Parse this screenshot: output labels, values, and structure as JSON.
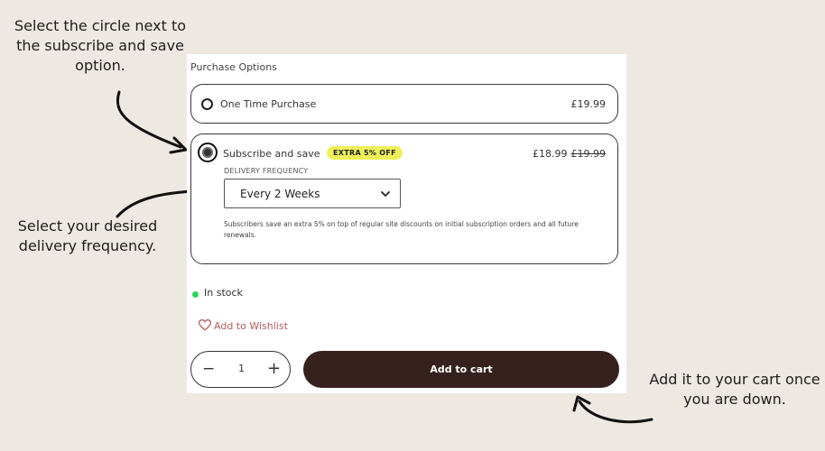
{
  "annotations": {
    "radio_hint": "Select the circle next to the subscribe and save option.",
    "frequency_hint": "Select your desired delivery frequency.",
    "cart_hint": "Add it to your cart once you are down."
  },
  "purchase": {
    "heading": "Purchase Options",
    "one_time": {
      "label": "One Time Purchase",
      "price": "£19.99",
      "selected": false
    },
    "subscribe": {
      "label": "Subscribe and save",
      "badge": "EXTRA 5% OFF",
      "price": "£18.99",
      "old_price": "£19.99",
      "selected": true,
      "frequency_label": "DELIVERY FREQUENCY",
      "frequency_value": "Every 2 Weeks",
      "info": "Subscribers save an extra 5% on top of regular site discounts on initial subscription orders and all future renewals."
    }
  },
  "stock": {
    "status": "In stock",
    "color": "#2bd65a"
  },
  "wishlist": {
    "label": "Add to Wishlist"
  },
  "quantity": {
    "minus": "−",
    "value": "1",
    "plus": "+"
  },
  "cart": {
    "label": "Add to cart",
    "color": "#36211f"
  },
  "colors": {
    "background": "#ede8e2",
    "badge": "#eef05a",
    "wishlist": "#b55a5a"
  }
}
